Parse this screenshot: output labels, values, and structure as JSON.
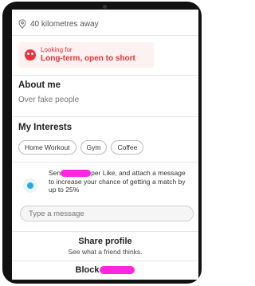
{
  "profile": {
    "distance": "40 kilometres away",
    "looking_for_label": "Looking for",
    "looking_for_value": "Long-term, open to short",
    "about_title": "About me",
    "about_text": "Over fake people",
    "interests_title": "My Interests",
    "interests": [
      "Home Workout",
      "Gym",
      "Coffee"
    ]
  },
  "super_like": {
    "text_before": "Sen",
    "text_after": "per Like, and attach a message to increase your chance of getting a match by up to 25%"
  },
  "message": {
    "placeholder": "Type a message"
  },
  "share": {
    "title": "Share profile",
    "subtitle": "See what a friend thinks."
  },
  "block": {
    "label": "Block"
  },
  "colors": {
    "accent": "#e3343a",
    "redaction": "#ff26e2",
    "superlike": "#2fa8e0"
  },
  "icons": {
    "distance": "location-pin-icon",
    "looking_for": "heart-eyes-emoji-icon",
    "super_like": "super-like-icon"
  }
}
